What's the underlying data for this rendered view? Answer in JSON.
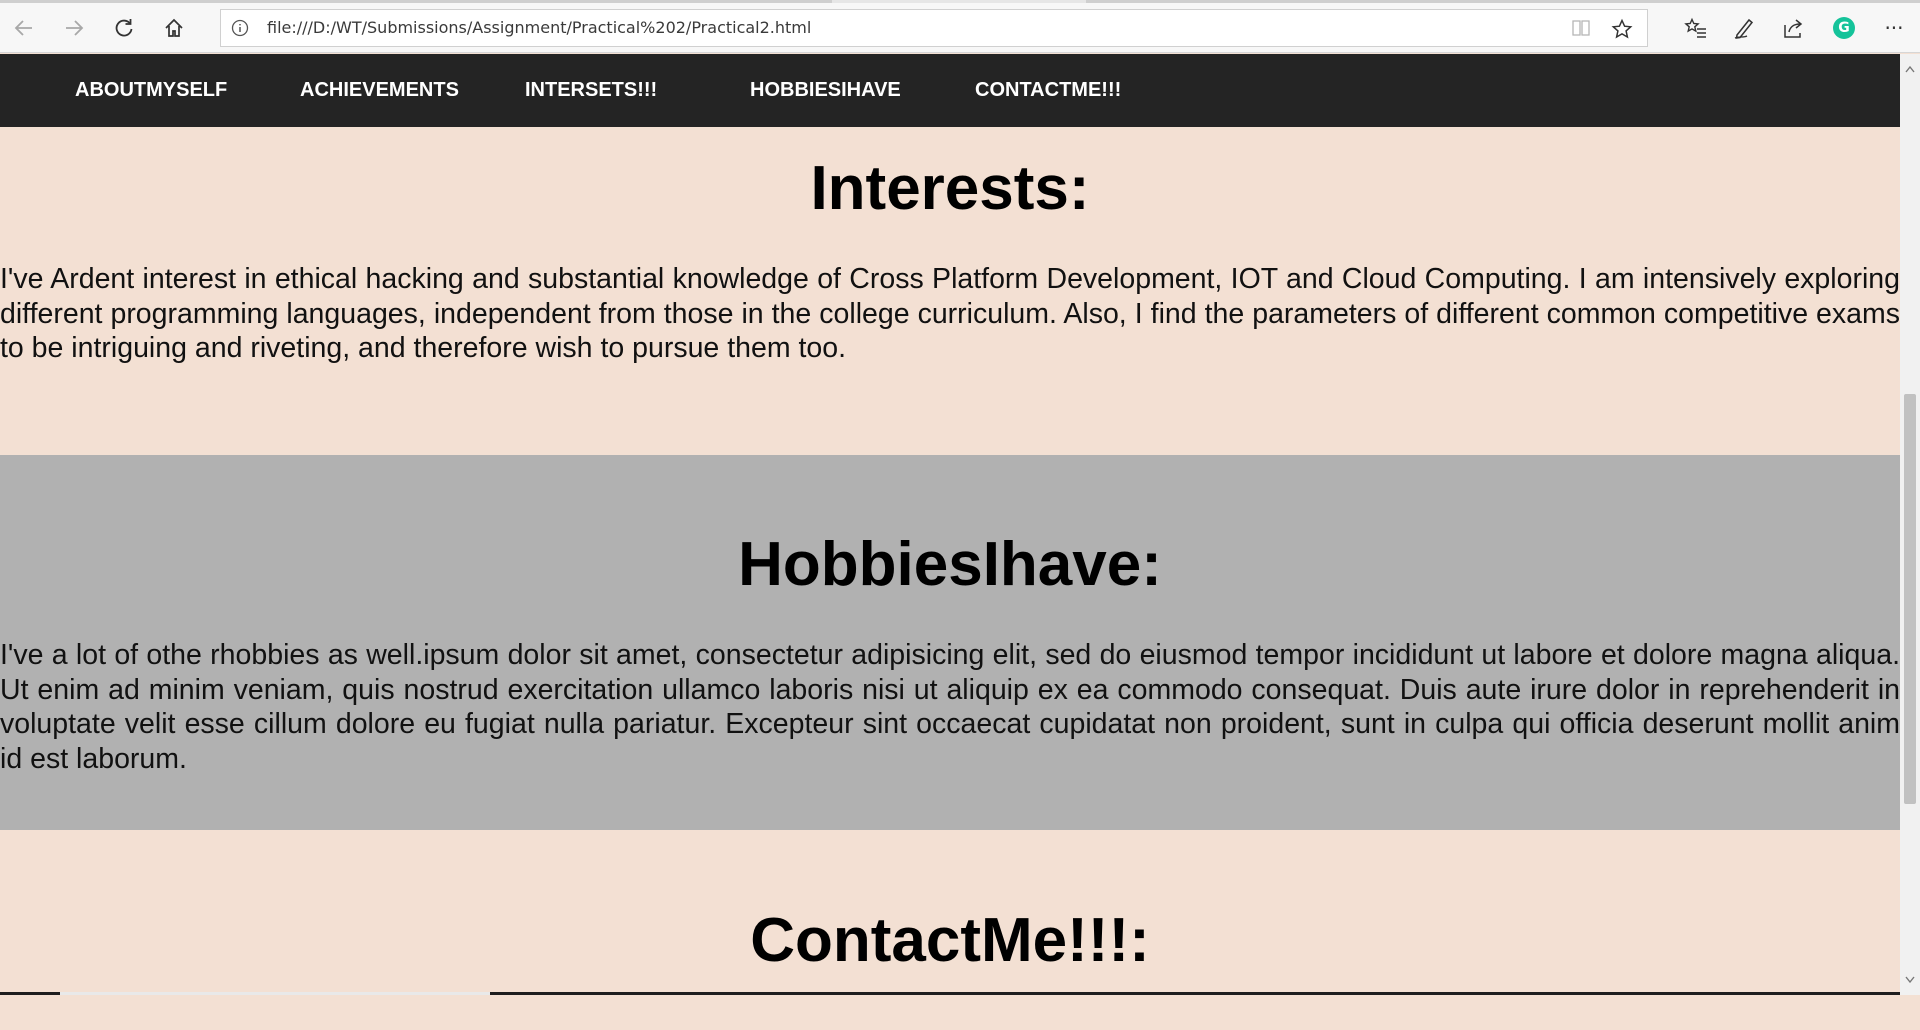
{
  "browser": {
    "url": "file:///D:/WT/Submissions/Assignment/Practical%202/Practical2.html",
    "icons": {
      "back": "back-arrow-icon",
      "forward": "forward-arrow-icon",
      "refresh": "refresh-icon",
      "home": "home-icon",
      "site_info": "info-icon",
      "reading_view": "reading-view-icon",
      "favorite": "star-icon",
      "favorites_hub": "favorites-list-icon",
      "notes": "pen-icon",
      "share": "share-icon",
      "extension": "grammarly-icon",
      "menu": "more-icon"
    },
    "extension_letter": "G",
    "menu_glyph": "···"
  },
  "nav": {
    "items": [
      {
        "label": "ABOUTMYSELF"
      },
      {
        "label": "ACHIEVEMENTS"
      },
      {
        "label": "INTERSETS!!!"
      },
      {
        "label": "HOBBIESIHAVE"
      },
      {
        "label": "CONTACTME!!!"
      }
    ]
  },
  "sections": {
    "interests": {
      "heading": "Interests:",
      "text": "I've Ardent interest in ethical hacking and substantial knowledge of Cross Platform Development, IOT and Cloud Computing. I am intensively exploring different programming languages, independent from those in the college curriculum. Also, I find the parameters of different common competitive exams to be intriguing and riveting, and therefore wish to pursue them too."
    },
    "hobbies": {
      "heading": "HobbiesIhave:",
      "text": "I've a lot of othe rhobbies as well.ipsum dolor sit amet, consectetur adipisicing elit, sed do eiusmod tempor incididunt ut labore et dolore magna aliqua. Ut enim ad minim veniam, quis nostrud exercitation ullamco laboris nisi ut aliquip ex ea commodo consequat. Duis aute irure dolor in reprehenderit in voluptate velit esse cillum dolore eu fugiat nulla pariatur. Excepteur sint occaecat cupidatat non proident, sunt in culpa qui officia deserunt mollit anim id est laborum."
    },
    "contact": {
      "heading": "ContactMe!!!:"
    }
  },
  "colors": {
    "page_bg": "#f3e0d3",
    "nav_bg": "#242424",
    "hobbies_bg": "#b1b1b1",
    "grammarly": "#15c39a"
  }
}
